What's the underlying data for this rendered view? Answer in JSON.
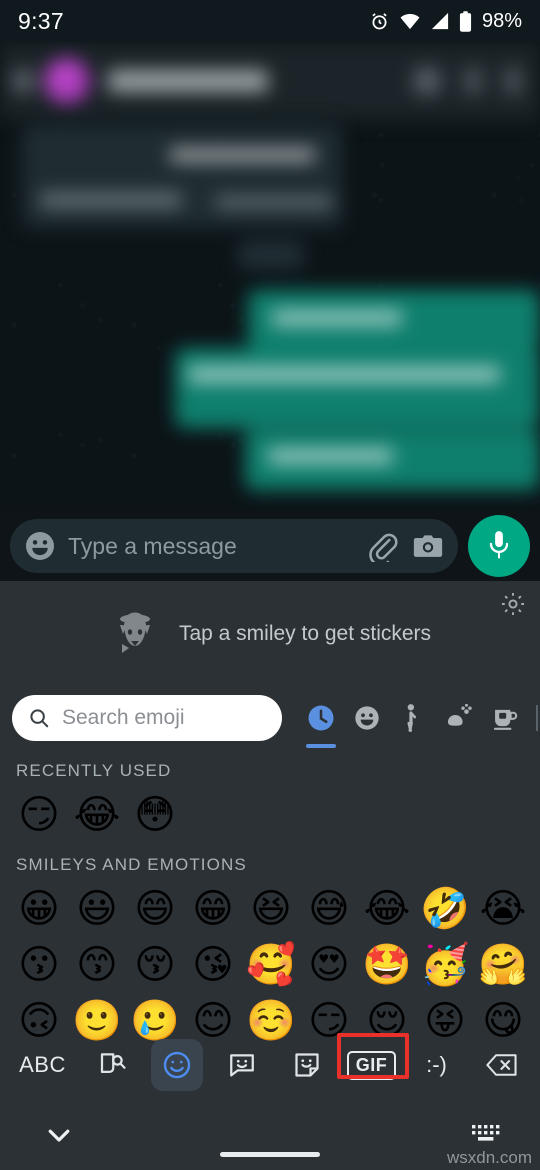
{
  "status_bar": {
    "time": "9:37",
    "battery_percent": "98%",
    "icons": [
      "alarm-icon",
      "wifi-icon",
      "cellular-signal-icon",
      "battery-icon"
    ]
  },
  "chat": {
    "blurred": true,
    "app_bar": {
      "back_icon": "back-arrow-icon",
      "avatar": "contact-avatar",
      "contact_name_blurred": "",
      "actions": [
        "video-call-icon",
        "voice-call-icon",
        "more-options-icon"
      ]
    },
    "messages_blurred_note": ""
  },
  "input_bar": {
    "emoji_icon": "emoji-smiley-icon",
    "placeholder": "Type a message",
    "value": "",
    "attach_icon": "paperclip-icon",
    "camera_icon": "camera-icon",
    "mic_icon": "microphone-icon",
    "mic_color": "#00a884"
  },
  "sticker_hint": {
    "mascot_icon": "sticker-mascot-icon",
    "text": "Tap a smiley to get stickers",
    "settings_icon": "gear-icon"
  },
  "emoji_panel": {
    "search": {
      "icon": "search-icon",
      "placeholder": "Search emoji",
      "value": ""
    },
    "category_tabs": [
      {
        "name": "recent",
        "icon": "clock-icon",
        "active": true
      },
      {
        "name": "smileys",
        "icon": "smiley-icon",
        "active": false
      },
      {
        "name": "people",
        "icon": "person-waving-icon",
        "active": false
      },
      {
        "name": "nature",
        "icon": "plant-flower-icon",
        "active": false
      },
      {
        "name": "food",
        "icon": "coffee-cup-icon",
        "active": false
      }
    ],
    "active_tab_color": "#5b8fe0",
    "sections": [
      {
        "title": "RECENTLY USED",
        "emojis": [
          "😏",
          "😂",
          "😳"
        ]
      },
      {
        "title": "SMILEYS AND EMOTIONS",
        "rows": [
          [
            "😀",
            "😃",
            "😄",
            "😁",
            "😆",
            "😅",
            "😂",
            "🤣",
            "😭"
          ],
          [
            "😗",
            "😙",
            "😚",
            "😘",
            "🥰",
            "😍",
            "🤩",
            "🥳",
            "🤗"
          ],
          [
            "🙃",
            "🙂",
            "🥲",
            "😊",
            "☺️",
            "😏",
            "😌",
            "😝",
            "😋"
          ]
        ]
      }
    ]
  },
  "key_row": {
    "keys": [
      {
        "name": "abc-key",
        "label": "ABC",
        "icon": null,
        "active": false
      },
      {
        "name": "sticker-search-key",
        "label": "",
        "icon": "sticker-search-icon",
        "active": false
      },
      {
        "name": "emoji-key",
        "label": "",
        "icon": "emoji-smiley-icon",
        "active": true
      },
      {
        "name": "emoji-bubble-key",
        "label": "",
        "icon": "emoji-bubble-icon",
        "active": false
      },
      {
        "name": "sticker-key",
        "label": "",
        "icon": "sticker-icon",
        "active": false
      },
      {
        "name": "gif-key",
        "label": "GIF",
        "icon": "gif-icon",
        "active": false,
        "highlighted": true
      },
      {
        "name": "emoticon-key",
        "label": ":-)",
        "icon": null,
        "active": false
      },
      {
        "name": "backspace-key",
        "label": "",
        "icon": "backspace-icon",
        "active": false
      }
    ],
    "highlight_color": "#e8312a"
  },
  "nav_bar": {
    "down_icon": "chevron-down-icon",
    "home_indicator": "home-indicator",
    "keyboard_icon": "keyboard-icon"
  },
  "watermark": {
    "text": "wsxdn.com"
  }
}
